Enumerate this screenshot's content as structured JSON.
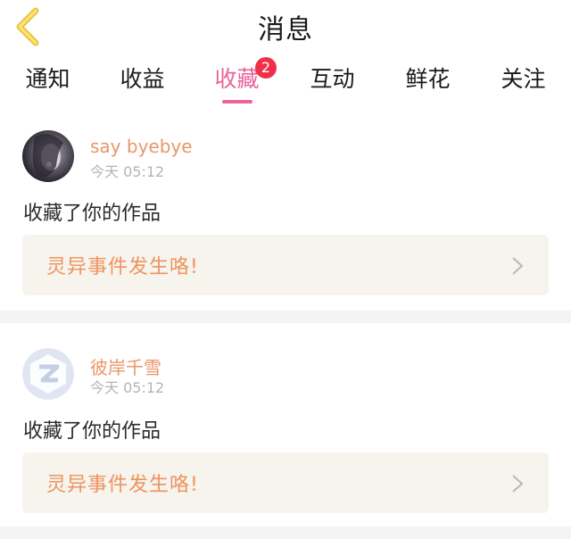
{
  "header": {
    "title": "消息",
    "back_icon": "chevron-left-icon",
    "back_color": "#e8c640"
  },
  "tabs": [
    {
      "label": "通知"
    },
    {
      "label": "收益"
    },
    {
      "label": "收藏",
      "active": true,
      "badge": "2"
    },
    {
      "label": "互动"
    },
    {
      "label": "鲜花"
    },
    {
      "label": "关注"
    }
  ],
  "messages": [
    {
      "username": "say byebye",
      "time": "今天 05:12",
      "action": "收藏了你的作品",
      "work_title": "灵异事件发生咯!",
      "avatar_icon": "user-photo-avatar"
    },
    {
      "username": "彼岸千雪",
      "time": "今天 05:12",
      "action": "收藏了你的作品",
      "work_title": "灵异事件发生咯!",
      "avatar_icon": "default-z-avatar"
    }
  ],
  "colors": {
    "accent": "#e8649b",
    "badge": "#f0304a",
    "username": "#e9966a",
    "work_title": "#ee9360",
    "work_bg": "#f6f4ec"
  }
}
